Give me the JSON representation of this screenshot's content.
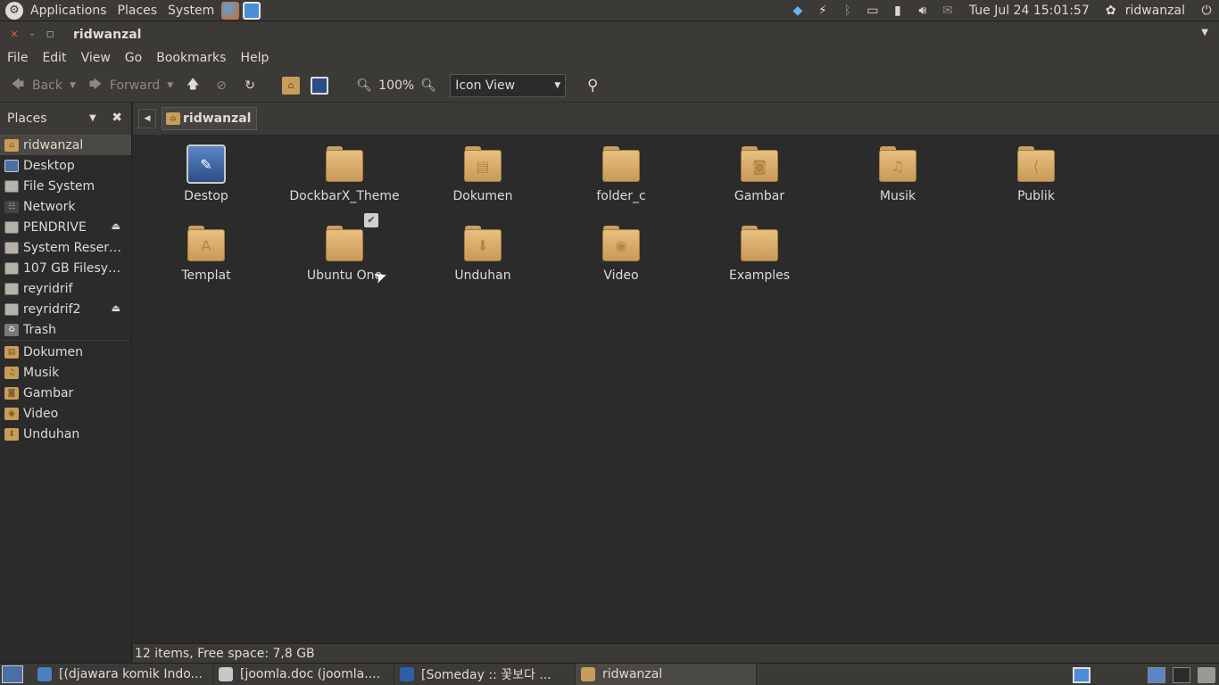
{
  "top_panel": {
    "menus": [
      "Applications",
      "Places",
      "System"
    ],
    "clock": "Tue Jul 24 15:01:57",
    "user": "ridwanzal"
  },
  "window": {
    "title": "ridwanzal",
    "menubar": [
      "File",
      "Edit",
      "View",
      "Go",
      "Bookmarks",
      "Help"
    ]
  },
  "toolbar": {
    "back_label": "Back",
    "forward_label": "Forward",
    "zoom": "100%",
    "view_mode": "Icon View"
  },
  "sidebar": {
    "title": "Places",
    "devices": [
      {
        "label": "ridwanzal",
        "icon": "home-folder"
      },
      {
        "label": "Desktop",
        "icon": "desktop"
      },
      {
        "label": "File System",
        "icon": "drive"
      },
      {
        "label": "Network",
        "icon": "network"
      },
      {
        "label": "PENDRIVE",
        "icon": "drive"
      },
      {
        "label": "System Reserved",
        "icon": "drive"
      },
      {
        "label": "107 GB Filesys...",
        "icon": "drive"
      },
      {
        "label": "reyridrif",
        "icon": "drive"
      },
      {
        "label": "reyridrif2",
        "icon": "drive"
      },
      {
        "label": "Trash",
        "icon": "trash"
      }
    ],
    "bookmarks": [
      {
        "label": "Dokumen",
        "icon": "folder"
      },
      {
        "label": "Musik",
        "icon": "folder"
      },
      {
        "label": "Gambar",
        "icon": "folder"
      },
      {
        "label": "Video",
        "icon": "folder"
      },
      {
        "label": "Unduhan",
        "icon": "folder"
      }
    ]
  },
  "pathbar": {
    "crumb": "ridwanzal"
  },
  "files": [
    {
      "label": "Destop",
      "type": "desktop"
    },
    {
      "label": "DockbarX_Theme",
      "type": "folder",
      "glyph": ""
    },
    {
      "label": "Dokumen",
      "type": "folder",
      "glyph": "▤"
    },
    {
      "label": "folder_c",
      "type": "folder",
      "glyph": ""
    },
    {
      "label": "Gambar",
      "type": "folder",
      "glyph": "◙"
    },
    {
      "label": "Musik",
      "type": "folder",
      "glyph": "♫"
    },
    {
      "label": "Publik",
      "type": "folder",
      "glyph": "⟨"
    },
    {
      "label": "Templat",
      "type": "folder",
      "glyph": "A"
    },
    {
      "label": "Ubuntu One",
      "type": "folder",
      "glyph": "",
      "emblem": "✔"
    },
    {
      "label": "Unduhan",
      "type": "folder",
      "glyph": "⬇"
    },
    {
      "label": "Video",
      "type": "folder",
      "glyph": "◉"
    },
    {
      "label": "Examples",
      "type": "folder",
      "glyph": ""
    }
  ],
  "status": "12 items, Free space: 7,8 GB",
  "taskbar": [
    {
      "label": "[(djawara komik Indo...",
      "icon_color": "#4a7fc0"
    },
    {
      "label": "[joomla.doc (joomla....",
      "icon_color": "#c8c8c8"
    },
    {
      "label": "[Someday :: 꽃보다 ...",
      "icon_color": "#2f5fa8"
    },
    {
      "label": "ridwanzal",
      "icon_color": "#c89c5a",
      "active": true
    }
  ]
}
